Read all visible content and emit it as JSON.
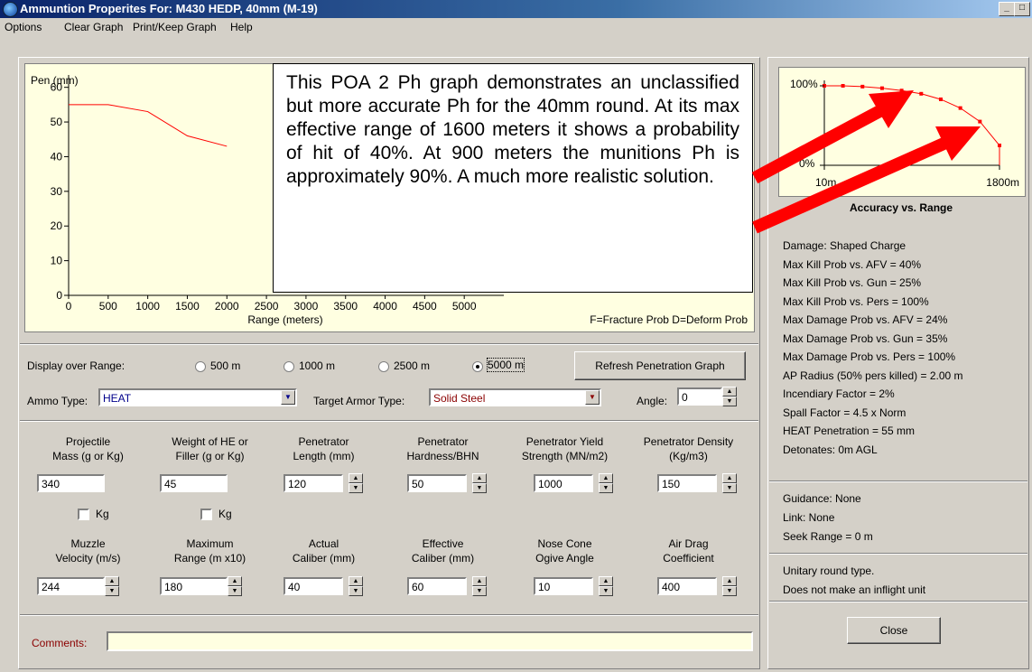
{
  "window": {
    "title": "Ammuntion Properites For: M430 HEDP, 40mm  (M-19)"
  },
  "menu": [
    "Options",
    "Clear Graph",
    "Print/Keep Graph",
    "Help"
  ],
  "pen_chart": {
    "ylabel": "Pen (mm)",
    "xlabel": "Range (meters)",
    "legend": "F=Fracture Prob   D=Deform Prob",
    "yticks": [
      "60",
      "50",
      "40",
      "30",
      "20",
      "10",
      "0"
    ],
    "xticks": [
      "0",
      "500",
      "1000",
      "1500",
      "2000",
      "2500",
      "3000",
      "3500",
      "4000",
      "4500",
      "5000"
    ],
    "partial_labels": [
      "...",
      "..."
    ]
  },
  "chart_data": [
    {
      "type": "line",
      "ylabel": "Pen (mm)",
      "xlabel": "Range (meters)",
      "x": [
        0,
        500,
        1000,
        1500,
        2000
      ],
      "y": [
        55,
        55,
        53,
        46,
        43
      ],
      "xlim": [
        0,
        5500
      ],
      "ylim": [
        0,
        62
      ],
      "color": "#ff0000"
    },
    {
      "type": "line",
      "title": "Accuracy vs. Range",
      "x": [
        10,
        200,
        400,
        600,
        800,
        1000,
        1200,
        1400,
        1600,
        1800
      ],
      "y": [
        100,
        100,
        99,
        97,
        94,
        90,
        83,
        72,
        55,
        25
      ],
      "xticks": [
        "10m",
        "1800m"
      ],
      "yticks": [
        "100%",
        "0%"
      ],
      "color": "#ff0000"
    }
  ],
  "annotation": "This POA 2 Ph graph demonstrates an unclassified but more accurate  Ph for the 40mm round. At its max effective range of 1600 meters it shows a probability of hit of 40%.  At 900 meters the munitions Ph is approximately 90%. A much more realistic solution.",
  "accuracy_chart": {
    "title": "Accuracy vs. Range",
    "y_top": "100%",
    "y_bottom": "0%",
    "x_left": "10m",
    "x_right": "1800m"
  },
  "range": {
    "label": "Display over Range:",
    "options": [
      "500 m",
      "1000 m",
      "2500 m",
      "5000 m"
    ],
    "selected": "5000 m",
    "refresh_label": "Refresh Penetration Graph"
  },
  "ammo": {
    "label": "Ammo Type:",
    "value": "HEAT"
  },
  "target": {
    "label": "Target Armor Type:",
    "value": "Solid Steel"
  },
  "angle": {
    "label": "Angle:",
    "value": "0"
  },
  "params_row1": [
    {
      "l1": "Projectile",
      "l2": "Mass (g or Kg)",
      "value": "340"
    },
    {
      "l1": "Weight of HE or",
      "l2": "Filler (g or Kg)",
      "value": "45"
    },
    {
      "l1": "Penetrator",
      "l2": "Length (mm)",
      "value": "120"
    },
    {
      "l1": "Penetrator",
      "l2": "Hardness/BHN",
      "value": "50"
    },
    {
      "l1": "Penetrator Yield",
      "l2": "Strength (MN/m2)",
      "value": "1000"
    },
    {
      "l1": "Penetrator Density",
      "l2": "(Kg/m3)",
      "value": "150"
    }
  ],
  "kg_label": "Kg",
  "params_row2": [
    {
      "l1": "Muzzle",
      "l2": "Velocity (m/s)",
      "value": "244"
    },
    {
      "l1": "Maximum",
      "l2": "Range (m x10)",
      "value": "180"
    },
    {
      "l1": "Actual",
      "l2": "Caliber (mm)",
      "value": "40"
    },
    {
      "l1": "Effective",
      "l2": "Caliber (mm)",
      "value": "60"
    },
    {
      "l1": "Nose Cone",
      "l2": "Ogive Angle",
      "value": "10"
    },
    {
      "l1": "Air Drag",
      "l2": "Coefficient",
      "value": "400"
    }
  ],
  "comments": {
    "label": "Comments:",
    "value": ""
  },
  "info1": [
    "Damage: Shaped Charge",
    "Max Kill Prob vs. AFV = 40%",
    "Max Kill Prob vs. Gun = 25%",
    "Max Kill Prob vs. Pers = 100%",
    "Max Damage Prob vs. AFV = 24%",
    "Max Damage Prob vs. Gun = 35%",
    "Max Damage Prob vs. Pers = 100%",
    "AP Radius (50% pers killed) = 2.00 m",
    "Incendiary Factor = 2%",
    "Spall Factor = 4.5 x Norm",
    "HEAT Penetration = 55 mm",
    "Detonates: 0m AGL"
  ],
  "info2": [
    "Guidance: None",
    "Link: None",
    "Seek Range = 0 m"
  ],
  "info3": [
    "Unitary round type.",
    "Does not make an inflight unit"
  ],
  "close_label": "Close"
}
